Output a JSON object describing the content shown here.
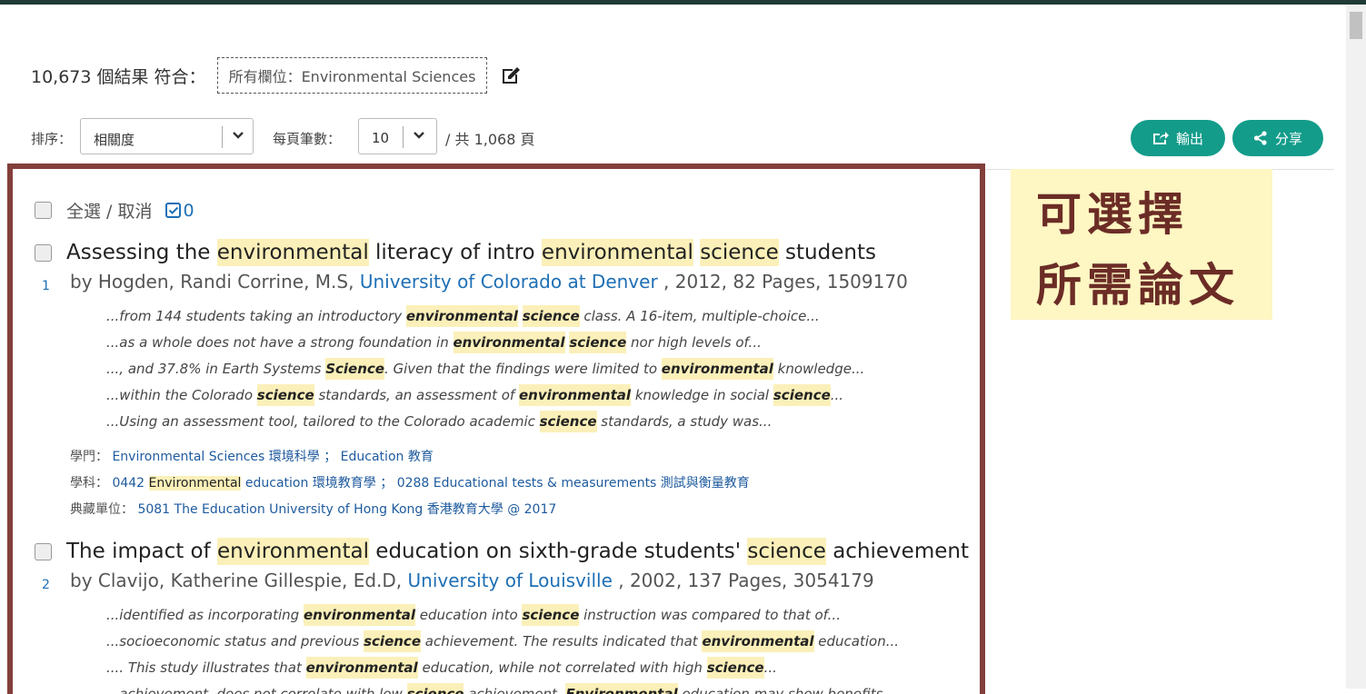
{
  "header": {
    "result_count": "10,673 個結果 符合：",
    "query": "所有欄位：Environmental Sciences"
  },
  "sort": {
    "label": "排序：",
    "value": "相關度",
    "per_page_label": "每頁筆數：",
    "per_page_value": "10",
    "pages": "/ 共 1,068 頁"
  },
  "actions": {
    "export_label": "輸出",
    "share_label": "分享",
    "accent": "#139c8a"
  },
  "annotation": {
    "line1": "可選擇",
    "line2": "所需論文"
  },
  "select_all": {
    "label": "全選 / 取消",
    "count": "0"
  },
  "results": [
    {
      "num": "1",
      "title": [
        {
          "t": "Assessing the "
        },
        {
          "t": "environmental",
          "h": true
        },
        {
          "t": " literacy of intro "
        },
        {
          "t": "environmental",
          "h": true
        },
        {
          "t": " "
        },
        {
          "t": "science",
          "h": true
        },
        {
          "t": " students"
        }
      ],
      "by": "by Hogden, Randi Corrine, M.S, ",
      "university": "University of Colorado at Denver",
      "details": " , 2012, 82 Pages, 1509170",
      "snippets": [
        [
          {
            "t": "...from 144 students taking an introductory "
          },
          {
            "t": "environmental",
            "h": true
          },
          {
            "t": " "
          },
          {
            "t": "science",
            "h": true
          },
          {
            "t": " class. A 16-item, multiple-choice..."
          }
        ],
        [
          {
            "t": "...as a whole does not have a strong foundation in "
          },
          {
            "t": "environmental",
            "h": true
          },
          {
            "t": " "
          },
          {
            "t": "science",
            "h": true
          },
          {
            "t": " nor high levels of..."
          }
        ],
        [
          {
            "t": "..., and 37.8% in Earth Systems "
          },
          {
            "t": "Science",
            "h": true
          },
          {
            "t": ". Given that the findings were limited to "
          },
          {
            "t": "environmental",
            "h": true
          },
          {
            "t": " knowledge..."
          }
        ],
        [
          {
            "t": "...within the Colorado "
          },
          {
            "t": "science",
            "h": true
          },
          {
            "t": " standards, an assessment of "
          },
          {
            "t": "environmental",
            "h": true
          },
          {
            "t": " knowledge in social "
          },
          {
            "t": "science",
            "h": true
          },
          {
            "t": "..."
          }
        ],
        [
          {
            "t": "...Using an assessment tool, tailored to the Colorado academic "
          },
          {
            "t": "science",
            "h": true
          },
          {
            "t": " standards, a study was..."
          }
        ]
      ],
      "meta": [
        [
          {
            "t": "學門： "
          },
          {
            "t": "Environmental Sciences 環境科學 ； Education 教育",
            "v": true
          }
        ],
        [
          {
            "t": "學科： "
          },
          {
            "t": "0442 ",
            "v": true
          },
          {
            "t": "Environmental",
            "h": true
          },
          {
            "t": " education 環境教育學 ； 0288 Educational tests & measurements 測試與衡量教育",
            "v": true
          }
        ],
        [
          {
            "t": "典藏單位： "
          },
          {
            "t": "5081 The Education University of Hong Kong 香港教育大學 @ 2017",
            "v": true
          }
        ]
      ]
    },
    {
      "num": "2",
      "title": [
        {
          "t": "The impact of "
        },
        {
          "t": "environmental",
          "h": true
        },
        {
          "t": " education on sixth-grade students' "
        },
        {
          "t": "science",
          "h": true
        },
        {
          "t": " achievement"
        }
      ],
      "by": "by Clavijo, Katherine Gillespie, Ed.D, ",
      "university": "University of Louisville",
      "details": " , 2002, 137 Pages, 3054179",
      "snippets": [
        [
          {
            "t": "...identified as incorporating "
          },
          {
            "t": "environmental",
            "h": true
          },
          {
            "t": " education into "
          },
          {
            "t": "science",
            "h": true
          },
          {
            "t": " instruction was compared to that of..."
          }
        ],
        [
          {
            "t": "...socioeconomic status and previous "
          },
          {
            "t": "science",
            "h": true
          },
          {
            "t": " achievement. The results indicated that "
          },
          {
            "t": "environmental",
            "h": true
          },
          {
            "t": " education..."
          }
        ],
        [
          {
            "t": ".... This study illustrates that "
          },
          {
            "t": "environmental",
            "h": true
          },
          {
            "t": " education, while not correlated with high "
          },
          {
            "t": "science",
            "h": true
          },
          {
            "t": "..."
          }
        ],
        [
          {
            "t": "...achievement, does not correlate with low "
          },
          {
            "t": "science",
            "h": true
          },
          {
            "t": " achievement. "
          },
          {
            "t": "Environmental",
            "h": true
          },
          {
            "t": " education may show benefits..."
          }
        ]
      ],
      "meta": []
    }
  ]
}
